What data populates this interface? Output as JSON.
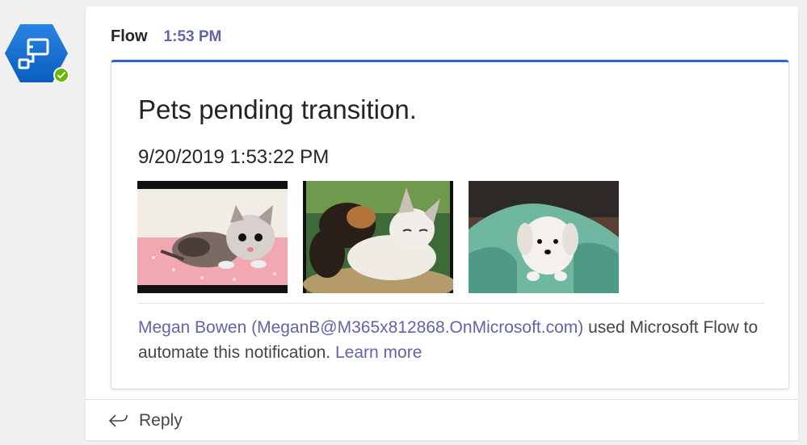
{
  "avatar": {
    "name": "flow-app-logo",
    "status": "available",
    "status_color": "#6bb700",
    "brand_color": "#0078d4"
  },
  "message": {
    "sender": "Flow",
    "time": "1:53 PM",
    "accent_color": "#2f66c9"
  },
  "card": {
    "title": "Pets pending transition.",
    "date": "9/20/2019 1:53:22 PM",
    "images": [
      {
        "icon": "kitten-photo"
      },
      {
        "icon": "puppy-and-cat-photo"
      },
      {
        "icon": "white-puppy-photo"
      }
    ],
    "footer": {
      "user_link": "Megan Bowen (MeganB@M365x812868.OnMicrosoft.com)",
      "text_part1": " used Microsoft Flow to automate this notification. ",
      "learn_more": "Learn more"
    }
  },
  "reply": {
    "icon": "reply-arrow-icon",
    "label": "Reply"
  }
}
